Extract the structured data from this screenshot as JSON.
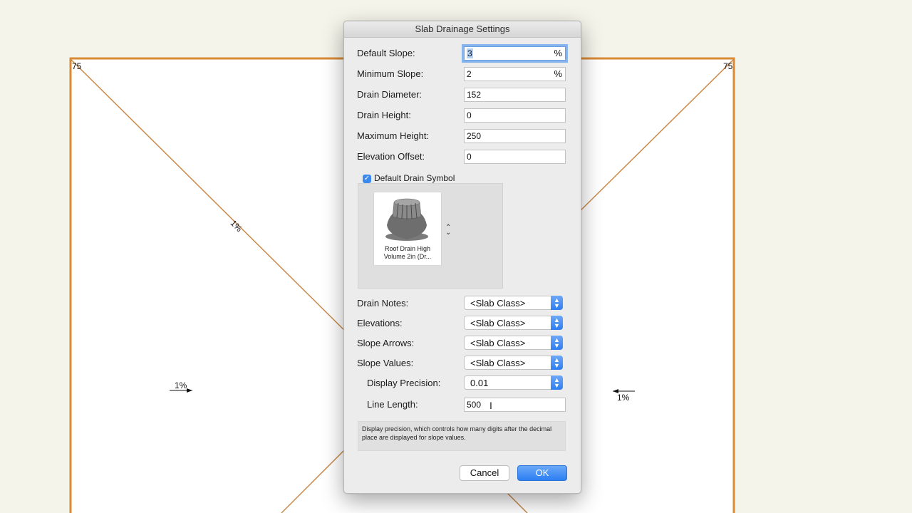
{
  "drawing": {
    "corner_left": "75",
    "corner_right": "75",
    "slope_diag": "1%",
    "slope_left": "1%",
    "slope_right": "1%",
    "line_color": "#d98a35"
  },
  "dialog": {
    "title": "Slab Drainage Settings",
    "fields": [
      {
        "label": "Default Slope:",
        "value": "3",
        "unit": "%"
      },
      {
        "label": "Minimum Slope:",
        "value": "2",
        "unit": "%"
      },
      {
        "label": "Drain Diameter:",
        "value": "152"
      },
      {
        "label": "Drain Height:",
        "value": "0"
      },
      {
        "label": "Maximum Height:",
        "value": "250"
      },
      {
        "label": "Elevation Offset:",
        "value": "0"
      }
    ],
    "checkbox_label": "Default Drain Symbol",
    "symbol_caption": "Roof Drain High Volume 2in (Dr...",
    "popups": [
      {
        "label": "Drain Notes:",
        "value": "<Slab Class>"
      },
      {
        "label": "Elevations:",
        "value": "<Slab Class>"
      },
      {
        "label": "Slope Arrows:",
        "value": "<Slab Class>"
      },
      {
        "label": "Slope Values:",
        "value": "<Slab Class>"
      },
      {
        "label": "Display Precision:",
        "value": "0.01"
      }
    ],
    "line_length": {
      "label": "Line Length:",
      "value": "500"
    },
    "help_text": "Display precision, which controls how many digits after the decimal place are displayed for slope values.",
    "cancel_label": "Cancel",
    "ok_label": "OK"
  }
}
